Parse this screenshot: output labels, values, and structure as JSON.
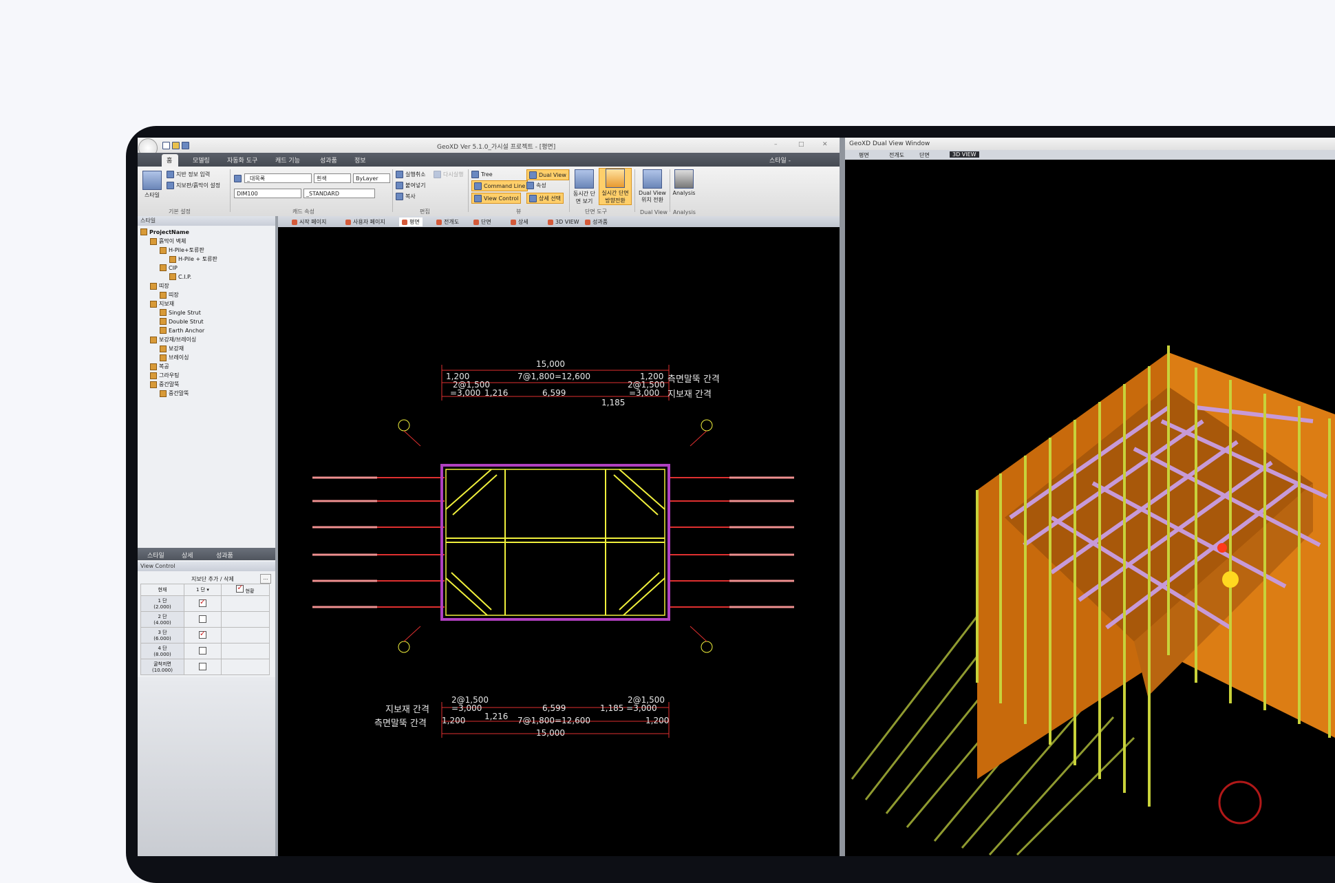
{
  "app": {
    "title": "GeoXD Ver 5.1.0_가시설 프로젝트 - [평면]",
    "window_controls": [
      "–",
      "□",
      "✕"
    ]
  },
  "menu": {
    "items": [
      "홈",
      "모델링",
      "자동화 도구",
      "캐드 기능",
      "성과품",
      "정보"
    ],
    "right_label": "스타일 -"
  },
  "ribbon": {
    "groups": [
      "기본 설정",
      "캐드 속성",
      "편집",
      "뷰",
      "단면 도구",
      "Dual View",
      "Analysis"
    ],
    "style_button": "스타일",
    "ground_input": "지반 정보 입력",
    "wall_settings": "지보판/흙막이 설정",
    "layer_value": "_대목록",
    "color_value": "흰색",
    "linetype_value": "ByLayer",
    "dim_value": "DIM100",
    "textstyle_value": "_STANDARD",
    "edit_buttons": [
      "실행취소",
      "다시실행",
      "붙여넣기",
      "복사"
    ],
    "view_buttons": [
      "Tree",
      "Dual View",
      "Command Line",
      "속성",
      "View Control",
      "상세 선택"
    ],
    "section_buttons": [
      "동시간 단면 보기",
      "실시간 단면 방향전환"
    ],
    "dual_view_button": "Dual View 위치 전환",
    "analysis_button": "Analysis"
  },
  "left_panel": {
    "header": "스타일",
    "tree": [
      {
        "label": "ProjectName",
        "level": 0
      },
      {
        "label": "흙막이 벽체",
        "level": 1
      },
      {
        "label": "H-Pile+토류판",
        "level": 2
      },
      {
        "label": "H-Pile + 토류판",
        "level": 3
      },
      {
        "label": "CIP",
        "level": 2
      },
      {
        "label": "C.I.P.",
        "level": 3
      },
      {
        "label": "띠장",
        "level": 1
      },
      {
        "label": "띠장",
        "level": 2
      },
      {
        "label": "지보재",
        "level": 1
      },
      {
        "label": "Single Strut",
        "level": 2
      },
      {
        "label": "Double Strut",
        "level": 2
      },
      {
        "label": "Earth Anchor",
        "level": 2
      },
      {
        "label": "보강재/브레이싱",
        "level": 1
      },
      {
        "label": "보강재",
        "level": 2
      },
      {
        "label": "브레이싱",
        "level": 2
      },
      {
        "label": "복공",
        "level": 1
      },
      {
        "label": "그라우팅",
        "level": 1
      },
      {
        "label": "중간말뚝",
        "level": 1
      },
      {
        "label": "중간말뚝",
        "level": 2
      }
    ],
    "bottom_tabs": [
      "스타일",
      "상세",
      "성과품"
    ],
    "view_control_header": "View Control",
    "view_control": {
      "add_remove_label": "지보단 추가 / 삭제",
      "col_stage": "현재",
      "col_current": "현황",
      "select_value": "1 단",
      "rows": [
        {
          "label": "1 단",
          "depth": "(2.000)",
          "checked": true
        },
        {
          "label": "2 단",
          "depth": "(4.000)",
          "checked": false
        },
        {
          "label": "3 단",
          "depth": "(6.000)",
          "checked": true
        },
        {
          "label": "4 단",
          "depth": "(8.000)",
          "checked": false
        },
        {
          "label": "굴착저면",
          "depth": "(10.000)",
          "checked": false
        }
      ]
    }
  },
  "doc_tabs": [
    "시작 페이지",
    "사용자 페이지",
    "평면",
    "전개도",
    "단면",
    "상세",
    "3D VIEW",
    "성과품"
  ],
  "cad": {
    "top_dim": {
      "total": "15,000",
      "left": "1,200",
      "middle": "7@1,800=12,600",
      "right": "1,200",
      "pile_label": "측면말뚝 간격",
      "left2a": "2@1,500",
      "left2b": "=3,000",
      "a": "1,216",
      "b": "6,599",
      "right2a": "2@1,500",
      "right2b": "=3,000",
      "support_label": "지보재 간격",
      "c": "1,185"
    },
    "bottom_dim": {
      "left2a": "2@1,500",
      "left2b": "=3,000",
      "b": "6,599",
      "right2a": "2@1,500",
      "right2b": "1,185 =3,000",
      "support_label": "지보재 간격",
      "a": "1,216",
      "pile_label": "측면말뚝 간격",
      "left": "1,200",
      "middle": "7@1,800=12,600",
      "right": "1,200",
      "total": "15,000"
    }
  },
  "dual_view": {
    "title": "GeoXD Dual View Window",
    "tabs": [
      "평면",
      "전개도",
      "단면",
      "3D VIEW"
    ]
  },
  "colors": {
    "wall": "#d9760f",
    "strut": "#c79ad8",
    "pile": "#c8d23a",
    "cad_yellow": "#f0f03c",
    "cad_magenta": "#b040c0",
    "cad_red": "#e03030"
  }
}
